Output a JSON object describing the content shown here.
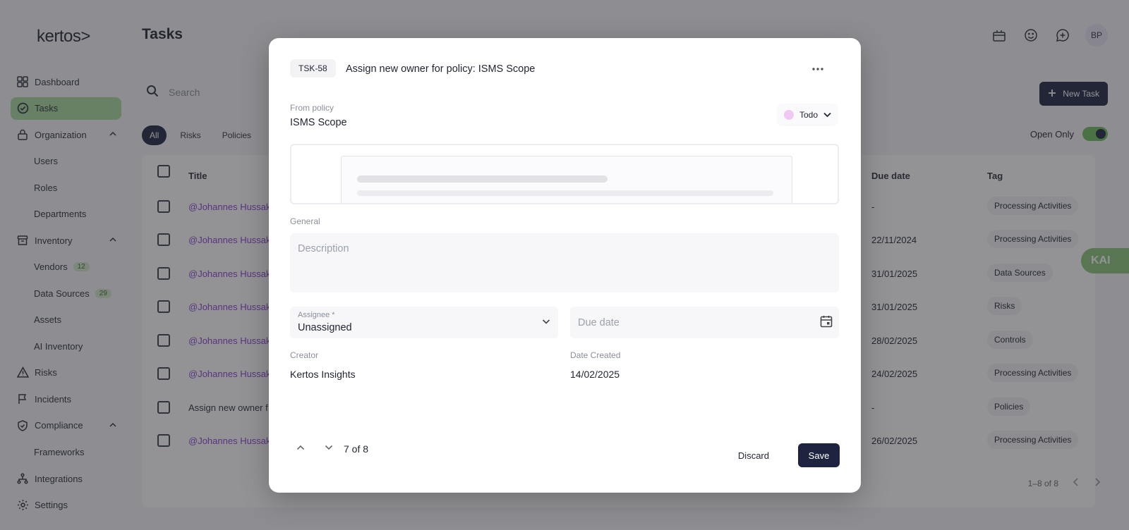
{
  "app": {
    "logo": "kertos>",
    "page_title": "Tasks"
  },
  "sidebar": {
    "items": [
      {
        "label": "Dashboard",
        "icon": "grid-icon"
      },
      {
        "label": "Tasks",
        "icon": "check-circle-icon"
      },
      {
        "label": "Organization",
        "icon": "lock-icon"
      },
      {
        "label": "Users"
      },
      {
        "label": "Roles"
      },
      {
        "label": "Departments"
      },
      {
        "label": "Inventory",
        "icon": "box-icon"
      },
      {
        "label": "Vendors",
        "badge": "12"
      },
      {
        "label": "Data Sources",
        "badge": "29"
      },
      {
        "label": "Assets"
      },
      {
        "label": "AI Inventory"
      },
      {
        "label": "Risks",
        "icon": "warning-icon"
      },
      {
        "label": "Incidents",
        "icon": "flag-icon"
      },
      {
        "label": "Compliance",
        "icon": "shield-check-icon"
      },
      {
        "label": "Frameworks"
      },
      {
        "label": "Integrations",
        "icon": "network-icon"
      },
      {
        "label": "Settings",
        "icon": "gear-icon"
      }
    ]
  },
  "header": {
    "avatar_initials": "BP"
  },
  "toolbar": {
    "search_placeholder": "Search",
    "new_task_label": "New Task",
    "open_only_label": "Open Only"
  },
  "filters": [
    "All",
    "Risks",
    "Policies"
  ],
  "table": {
    "columns": {
      "title": "Title",
      "due": "Due date",
      "tag": "Tag"
    },
    "rows": [
      {
        "title": "@Johannes Hussak",
        "due": "-",
        "tag": "Processing Activities"
      },
      {
        "title": "@Johannes Hussak",
        "due": "22/11/2024",
        "tag": "Processing Activities"
      },
      {
        "title": "@Johannes Hussak",
        "due": "31/01/2025",
        "tag": "Data Sources"
      },
      {
        "title": "@Johannes Hussak",
        "due": "31/01/2025",
        "tag": "Risks"
      },
      {
        "title": "@Johannes Hussak",
        "due": "28/02/2025",
        "tag": "Controls"
      },
      {
        "title": "@Johannes Hussak",
        "due": "24/02/2025",
        "tag": "Processing Activities"
      },
      {
        "title": "Assign new owner f",
        "due": "-",
        "tag": "Policies"
      },
      {
        "title": "@Johannes Hussak",
        "due": "26/02/2025",
        "tag": "Processing Activities"
      }
    ],
    "pagination": "1–8 of 8"
  },
  "kai_label": "KAI",
  "modal": {
    "task_id": "TSK-58",
    "task_title": "Assign new owner for policy: ISMS Scope",
    "from_label": "From policy",
    "from_value": "ISMS Scope",
    "status": "Todo",
    "general_label": "General",
    "description_placeholder": "Description",
    "assignee_label": "Assignee *",
    "assignee_value": "Unassigned",
    "due_placeholder": "Due date",
    "creator_label": "Creator",
    "creator_value": "Kertos Insights",
    "date_created_label": "Date Created",
    "date_created_value": "14/02/2025",
    "position": "7 of 8",
    "discard_label": "Discard",
    "save_label": "Save"
  }
}
